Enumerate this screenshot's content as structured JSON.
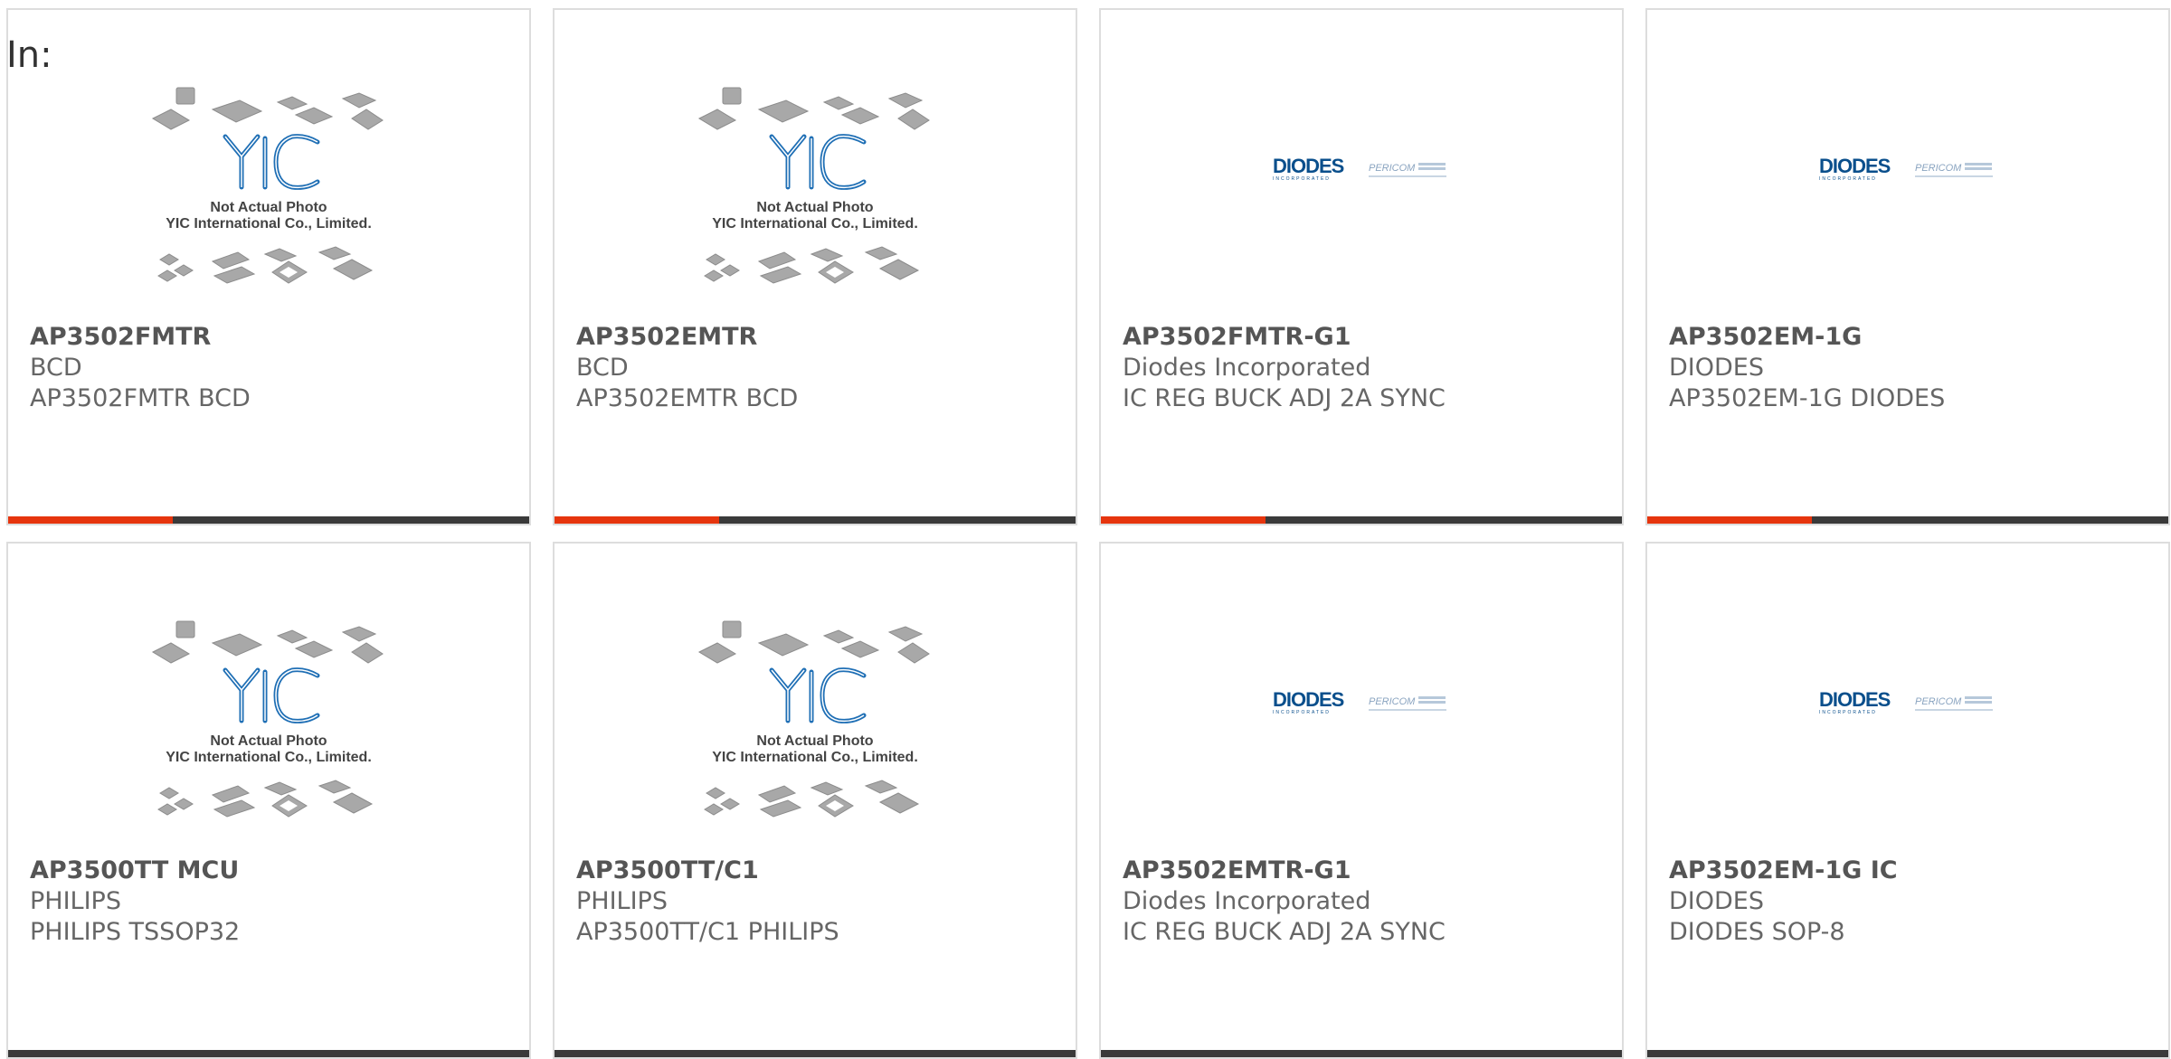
{
  "header": {
    "in_label": "In:"
  },
  "thumb_text": {
    "yic_logo": "YIC",
    "yic_line1": "Not Actual Photo",
    "yic_line2": "YIC International Co., Limited.",
    "diodes_logo": "DIODES",
    "diodes_sub": "INCORPORATED",
    "pericom_logo": "PERICOM"
  },
  "colors": {
    "accent": "#e6350e",
    "bar": "#3a3a3a",
    "yic_blue": "#1f6fb5",
    "diodes_blue": "#0a4f8c"
  },
  "products": [
    {
      "part": "AP3502FMTR",
      "maker": "BCD",
      "desc": "AP3502FMTR BCD",
      "image": "yic-placeholder"
    },
    {
      "part": "AP3502EMTR",
      "maker": "BCD",
      "desc": "AP3502EMTR BCD",
      "image": "yic-placeholder"
    },
    {
      "part": "AP3502FMTR-G1",
      "maker": "Diodes Incorporated",
      "desc": "IC REG BUCK ADJ 2A SYNC",
      "image": "diodes-pericom-logo"
    },
    {
      "part": "AP3502EM-1G",
      "maker": "DIODES",
      "desc": "AP3502EM-1G DIODES",
      "image": "diodes-pericom-logo"
    },
    {
      "part": "AP3500TT MCU",
      "maker": "PHILIPS",
      "desc": "PHILIPS TSSOP32",
      "image": "yic-placeholder"
    },
    {
      "part": "AP3500TT/C1",
      "maker": "PHILIPS",
      "desc": "AP3500TT/C1 PHILIPS",
      "image": "yic-placeholder"
    },
    {
      "part": "AP3502EMTR-G1",
      "maker": "Diodes Incorporated",
      "desc": "IC REG BUCK ADJ 2A SYNC",
      "image": "diodes-pericom-logo"
    },
    {
      "part": "AP3502EM-1G IC",
      "maker": "DIODES",
      "desc": "DIODES SOP-8",
      "image": "diodes-pericom-logo"
    }
  ]
}
